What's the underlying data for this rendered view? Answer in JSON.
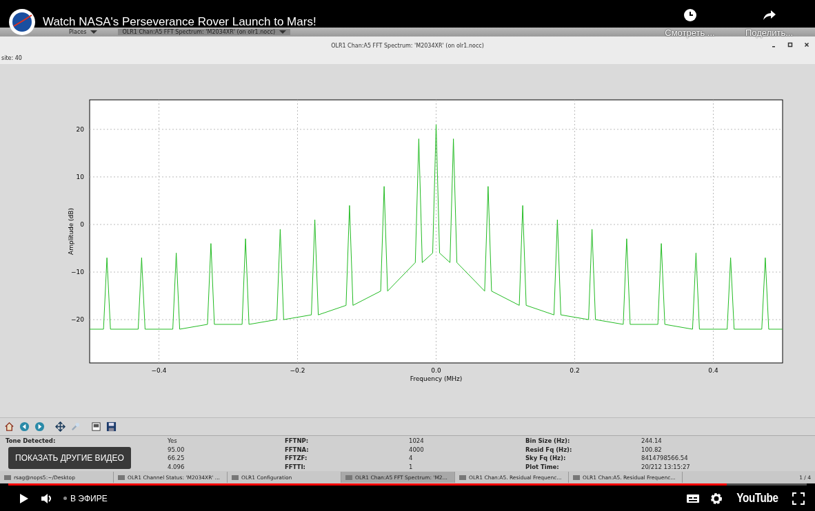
{
  "video": {
    "title": "Watch NASA's Perseverance Rover Launch to Mars!",
    "actions": [
      {
        "kind": "watch_later",
        "label": "Смотреть ..."
      },
      {
        "kind": "share",
        "label": "Поделить..."
      }
    ]
  },
  "desktop_panel": {
    "menus": [
      "Places"
    ],
    "window_button": "OLR1 Chan:A5 FFT Spectrum: 'M2034XR' (on olr1.nocc)"
  },
  "window": {
    "title": "OLR1 Chan:A5 FFT Spectrum: 'M2034XR' (on olr1.nocc)",
    "status": "site: 40"
  },
  "plot": {
    "chart_data": {
      "type": "line",
      "xlabel": "Frequency (MHz)",
      "ylabel": "Amplitude (dB)",
      "x": [
        -0.5,
        -0.48,
        -0.475,
        -0.47,
        -0.43,
        -0.425,
        -0.42,
        -0.38,
        -0.375,
        -0.37,
        -0.33,
        -0.325,
        -0.32,
        -0.28,
        -0.275,
        -0.27,
        -0.23,
        -0.225,
        -0.22,
        -0.18,
        -0.175,
        -0.17,
        -0.13,
        -0.125,
        -0.12,
        -0.08,
        -0.075,
        -0.07,
        -0.03,
        -0.025,
        -0.02,
        -0.005,
        0,
        0.005,
        0.02,
        0.025,
        0.03,
        0.07,
        0.075,
        0.08,
        0.12,
        0.125,
        0.13,
        0.17,
        0.175,
        0.18,
        0.22,
        0.225,
        0.23,
        0.27,
        0.275,
        0.28,
        0.32,
        0.325,
        0.33,
        0.37,
        0.375,
        0.38,
        0.42,
        0.425,
        0.43,
        0.47,
        0.475,
        0.48,
        0.5
      ],
      "grid": true,
      "series": [
        {
          "color": "#22bb22",
          "values": [
            -22,
            -22,
            -7,
            -22,
            -22,
            -7,
            -22,
            -22,
            -6,
            -22,
            -21,
            -4,
            -21,
            -21,
            -3,
            -21,
            -20,
            -1,
            -20,
            -19,
            1,
            -19,
            -17,
            4,
            -17,
            -14,
            8,
            -14,
            -8,
            18,
            -8,
            -6,
            21,
            -6,
            -8,
            18,
            -8,
            -14,
            8,
            -14,
            -17,
            4,
            -17,
            -19,
            1,
            -19,
            -20,
            -1,
            -20,
            -21,
            -3,
            -21,
            -21,
            -4,
            -21,
            -22,
            -6,
            -22,
            -22,
            -7,
            -22,
            -22,
            -7,
            -22,
            -22
          ]
        }
      ],
      "xlim": [
        -0.5,
        0.5
      ],
      "ylim": [
        -29.1,
        26.2
      ],
      "xticks": [
        {
          "value": -0.4,
          "label": "−0.4"
        },
        {
          "value": -0.2,
          "label": "−0.2"
        },
        {
          "value": 0,
          "label": "0.0"
        },
        {
          "value": 0.2,
          "label": "0.2"
        },
        {
          "value": 0.4,
          "label": "0.4"
        }
      ],
      "yticks": [
        {
          "value": 20,
          "label": "20"
        },
        {
          "value": 10,
          "label": "10"
        },
        {
          "value": 0,
          "label": "0"
        },
        {
          "value": -10,
          "label": "−10"
        },
        {
          "value": -20,
          "label": "−20"
        }
      ]
    }
  },
  "stats": {
    "rows": [
      {
        "label": "Tone Detected:",
        "cells": [
          "Yes",
          "FFTNP:",
          "1024",
          "Bin Size (Hz):",
          "244.14"
        ]
      },
      {
        "cells": [
          "95.00",
          "FFTNA:",
          "4000",
          "Resid Fq (Hz):",
          "100.82"
        ]
      },
      {
        "cells": [
          "66.25",
          "FFTZF:",
          "4",
          "Sky Fq (Hz):",
          "8414798566.54"
        ]
      },
      {
        "cells": [
          "4.096",
          "FFTTI:",
          "1",
          "Plot Time:",
          "20/212 13:15:27"
        ]
      }
    ]
  },
  "taskbar": {
    "items": [
      {
        "label": "rsag@nops5:~/Desktop",
        "selected": false
      },
      {
        "label": "OLR1 Channel Status: 'M2034XR' ...",
        "selected": false
      },
      {
        "label": "OLR1 Configuration",
        "selected": false
      },
      {
        "label": "OLR1 Chan:A5 FFT Spectrum: 'M2...",
        "selected": true
      },
      {
        "label": "OLR1 Chan:A5. Residual Frequenc...",
        "selected": false
      },
      {
        "label": "OLR1 Chan:A5. Residual Frequenc...",
        "selected": false
      }
    ],
    "pager": "1 / 4"
  },
  "overlay_button": "ПОКАЗАТЬ ДРУГИЕ ВИДЕО",
  "player": {
    "progress": {
      "level": 0.9
    },
    "live_label": "В ЭФИРЕ",
    "logo": "YouTube"
  }
}
